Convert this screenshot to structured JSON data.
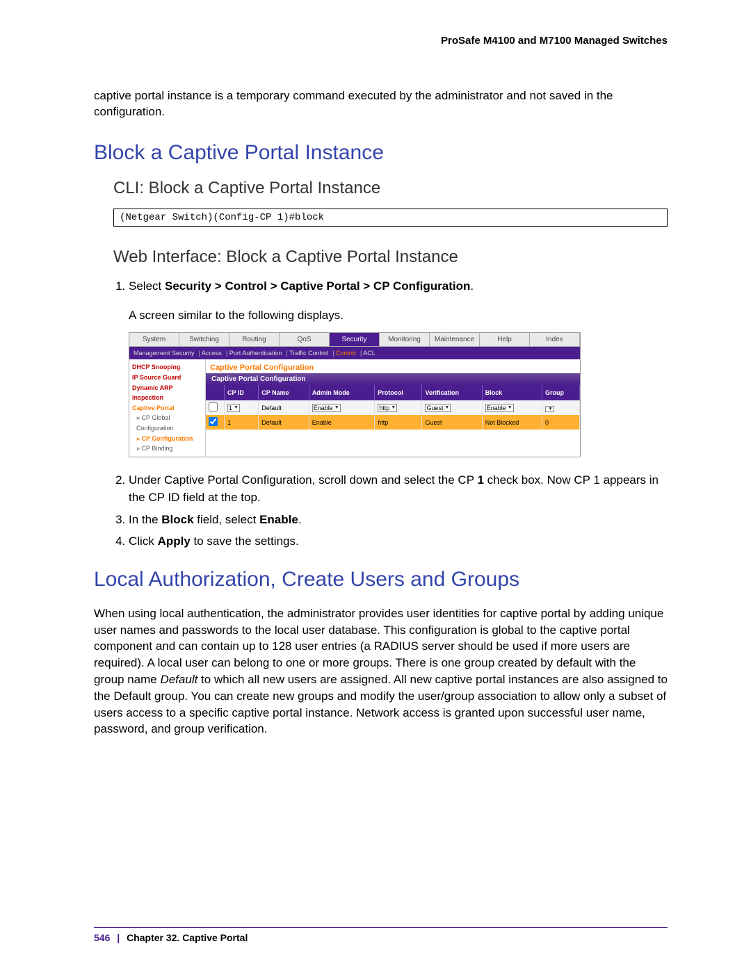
{
  "header": {
    "product": "ProSafe M4100 and M7100 Managed Switches"
  },
  "intro": "captive portal instance is a temporary command executed by the administrator and not saved in the configuration.",
  "h1": "Block a Captive Portal Instance",
  "h2_cli": "CLI: Block a Captive Portal Instance",
  "cli_code": "(Netgear Switch)(Config-CP 1)#block",
  "h2_web": "Web Interface: Block a Captive Portal Instance",
  "step1_prefix": "Select ",
  "step1_bold": "Security > Control > Captive Portal > CP Configuration",
  "step1_suffix": ".",
  "step1_sub": "A screen similar to the following displays.",
  "ui": {
    "tabs": [
      "System",
      "Switching",
      "Routing",
      "QoS",
      "Security",
      "Monitoring",
      "Maintenance",
      "Help",
      "Index"
    ],
    "subnav": [
      "Management Security",
      "Access",
      "Port Authentication",
      "Traffic Control",
      "Control",
      "ACL"
    ],
    "sidebar": [
      {
        "label": "DHCP Snooping",
        "cls": "red"
      },
      {
        "label": "IP Source Guard",
        "cls": "red"
      },
      {
        "label": "Dynamic ARP",
        "cls": "red"
      },
      {
        "label": "Inspection",
        "cls": "red"
      },
      {
        "label": "Captive Portal",
        "cls": "orange"
      },
      {
        "label": "» CP Global",
        "cls": "sub"
      },
      {
        "label": "Configuration",
        "cls": "sub"
      },
      {
        "label": "» CP Configuration",
        "cls": "sub orange"
      },
      {
        "label": "» CP Binding",
        "cls": "sub"
      }
    ],
    "panel_title": "Captive Portal Configuration",
    "panel_header": "Captive Portal Configuration",
    "columns": [
      "",
      "CP ID",
      "CP Name",
      "Admin Mode",
      "Protocol",
      "Verification",
      "Block",
      "Group"
    ],
    "rows": [
      {
        "checked": false,
        "cp_id": "1",
        "cp_name": "Default",
        "admin": "Enable",
        "proto": "http",
        "verif": "Guest",
        "block": "Enable",
        "group": "",
        "selected": false
      },
      {
        "checked": true,
        "cp_id": "1",
        "cp_name": "Default",
        "admin": "Enable",
        "proto": "http",
        "verif": "Guest",
        "block": "Not Blocked",
        "group": "0",
        "selected": true
      }
    ]
  },
  "step2_a": "Under Captive Portal Configuration, scroll down and select the CP ",
  "step2_b": "1",
  "step2_c": " check box. Now CP 1 appears in the CP ID field at the top.",
  "step3_a": "In the ",
  "step3_b": "Block",
  "step3_c": " field, select ",
  "step3_d": "Enable",
  "step3_e": ".",
  "step4_a": "Click ",
  "step4_b": "Apply",
  "step4_c": " to save the settings.",
  "h1_local": "Local Authorization, Create Users and Groups",
  "local_para_a": "When using local authentication, the administrator provides user identities for captive portal by adding unique user names and passwords to the local user database. This configuration is global to the captive portal component and can contain up to 128 user entries (a RADIUS server should be used if more users are required). A local user can belong to one or more groups. There is one group created by default with the group name ",
  "local_para_italic": "Default",
  "local_para_b": " to which all new users are assigned. All new captive portal instances are also assigned to the Default group. You can create new groups and modify the user/group association to allow only a subset of users access to a specific captive portal instance. Network access is granted upon successful user name, password, and group verification.",
  "footer": {
    "page": "546",
    "chapter": "Chapter 32.  Captive Portal"
  }
}
